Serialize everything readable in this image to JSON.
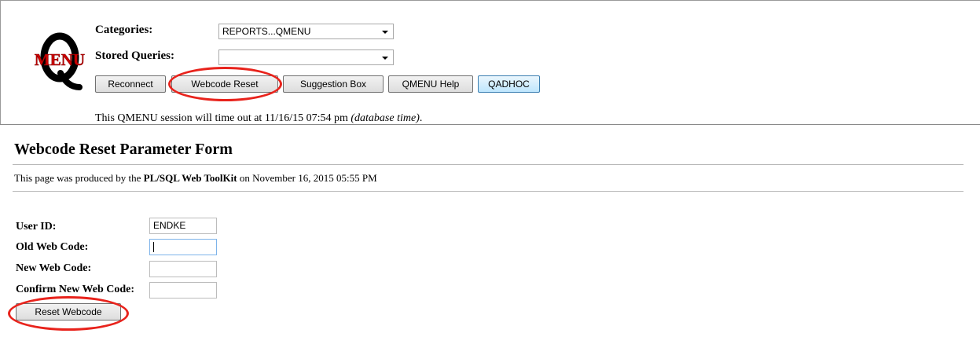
{
  "header": {
    "logo": {
      "letter": "Q",
      "word": "MENU"
    },
    "categories_label": "Categories:",
    "categories_value": "REPORTS...QMENU",
    "stored_queries_label": "Stored Queries:",
    "stored_queries_value": "",
    "buttons": [
      {
        "label": "Reconnect"
      },
      {
        "label": "Webcode Reset"
      },
      {
        "label": "Suggestion Box"
      },
      {
        "label": "QMENU Help"
      },
      {
        "label": "QADHOC"
      }
    ],
    "timeout_text": "This QMENU session will time out at 11/16/15 07:54 pm ",
    "timeout_note": "(database time)",
    "timeout_end": "."
  },
  "form": {
    "title": "Webcode Reset Parameter Form",
    "produced_prefix": "This page was produced by the ",
    "produced_tool": "PL/SQL Web ToolKit",
    "produced_suffix": " on November 16, 2015 05:55 PM",
    "fields": [
      {
        "label": "User ID:",
        "value": "ENDKE"
      },
      {
        "label": "Old Web Code:",
        "value": ""
      },
      {
        "label": "New Web Code:",
        "value": ""
      },
      {
        "label": "Confirm New Web Code:",
        "value": ""
      }
    ],
    "submit_label": "Reset Webcode"
  },
  "colors": {
    "annotation": "#e8231c",
    "logo_word": "#cc0000",
    "logo_letter": "#000000"
  }
}
